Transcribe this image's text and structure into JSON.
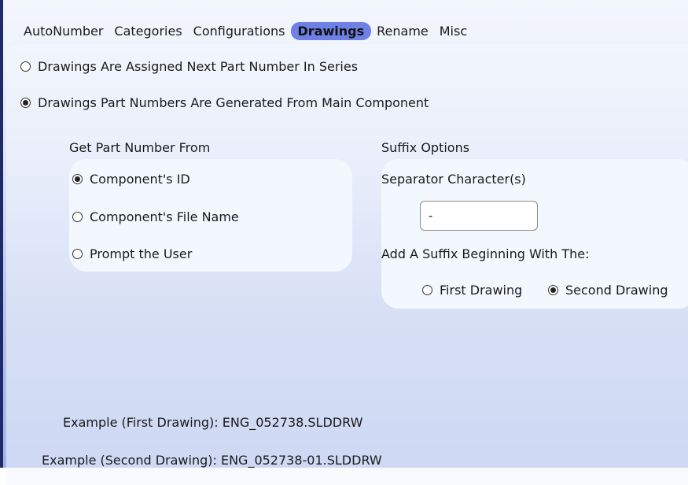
{
  "tabs": [
    {
      "label": "AutoNumber",
      "active": false
    },
    {
      "label": "Categories",
      "active": false
    },
    {
      "label": "Configurations",
      "active": false
    },
    {
      "label": "Drawings",
      "active": true
    },
    {
      "label": "Rename",
      "active": false
    },
    {
      "label": "Misc",
      "active": false
    }
  ],
  "mode": {
    "option_next": {
      "label": "Drawings Are Assigned Next Part Number In Series",
      "checked": false
    },
    "option_main": {
      "label": "Drawings Part Numbers Are Generated From Main Component",
      "checked": true
    }
  },
  "source": {
    "heading": "Get Part Number From",
    "options": [
      {
        "label": "Component's ID",
        "checked": true
      },
      {
        "label": "Component's File Name",
        "checked": false
      },
      {
        "label": "Prompt the User",
        "checked": false
      }
    ]
  },
  "suffix": {
    "heading": "Suffix Options",
    "separator_label": "Separator Character(s)",
    "separator_value": "-",
    "begin_label": "Add A Suffix Beginning With The:",
    "first_drawing": {
      "label": "First Drawing",
      "checked": false
    },
    "second_drawing": {
      "label": "Second Drawing",
      "checked": true
    }
  },
  "examples": {
    "first": "Example (First Drawing): ENG_052738.SLDDRW",
    "second": "Example (Second Drawing): ENG_052738-01.SLDDRW"
  },
  "colors": {
    "accent": "#6e7fe6",
    "border": "#1e2a6a"
  }
}
